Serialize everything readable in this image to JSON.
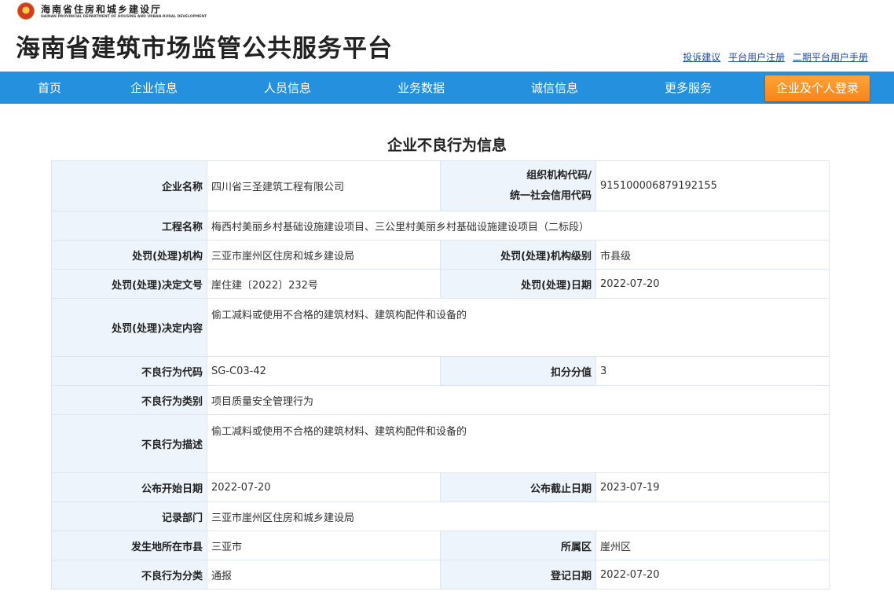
{
  "header": {
    "dept_name": "海南省住房和城乡建设厅",
    "dept_name_en": "HAINAN PROVINCIAL DEPARTMENT OF HOUSING AND URBAN-RURAL DEVELOPMENT",
    "site_title": "海南省建筑市场监管公共服务平台",
    "links": [
      "投诉建议",
      "平台用户注册",
      "二期平台用户手册"
    ]
  },
  "nav": {
    "items": [
      "首页",
      "企业信息",
      "人员信息",
      "业务数据",
      "诚信信息",
      "更多服务"
    ],
    "login": "企业及个人登录"
  },
  "page_title": "企业不良行为信息",
  "record": {
    "enterprise_name_label": "企业名称",
    "enterprise_name": "四川省三圣建筑工程有限公司",
    "org_code_label_1": "组织机构代码/",
    "org_code_label_2": "统一社会信用代码",
    "org_code": "915100006879192155",
    "project_name_label": "工程名称",
    "project_name": "梅西村美丽乡村基础设施建设项目、三公里村美丽乡村基础设施建设项目（二标段）",
    "authority_label": "处罚(处理)机构",
    "authority": "三亚市崖州区住房和城乡建设局",
    "authority_level_label": "处罚(处理)机构级别",
    "authority_level": "市县级",
    "decision_no_label": "处罚(处理)决定文号",
    "decision_no": "崖住建〔2022〕232号",
    "decision_date_label": "处罚(处理)日期",
    "decision_date": "2022-07-20",
    "decision_content_label": "处罚(处理)决定内容",
    "decision_content": "偷工减料或使用不合格的建筑材料、建筑构配件和设备的",
    "behavior_code_label": "不良行为代码",
    "behavior_code": "SG-C03-42",
    "deduction_label": "扣分分值",
    "deduction": "3",
    "behavior_type_label": "不良行为类别",
    "behavior_type": "项目质量安全管理行为",
    "behavior_desc_label": "不良行为描述",
    "behavior_desc": "偷工减料或使用不合格的建筑材料、建筑构配件和设备的",
    "publish_start_label": "公布开始日期",
    "publish_start": "2022-07-20",
    "publish_end_label": "公布截止日期",
    "publish_end": "2023-07-19",
    "record_dept_label": "记录部门",
    "record_dept": "三亚市崖州区住房和城乡建设局",
    "city_label": "发生地所在市县",
    "city": "三亚市",
    "district_label": "所属区",
    "district": "崖州区",
    "category_label": "不良行为分类",
    "category": "通报",
    "register_date_label": "登记日期",
    "register_date": "2022-07-20"
  }
}
